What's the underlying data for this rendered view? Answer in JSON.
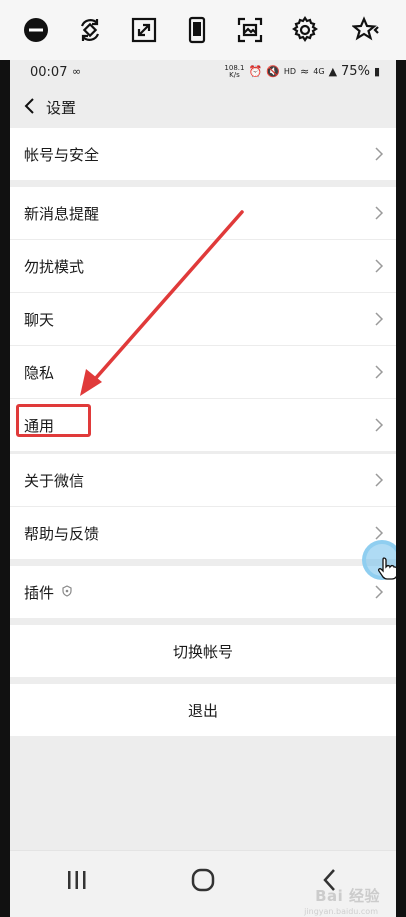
{
  "status_bar": {
    "time": "00:07",
    "network_speed_value": "108.1",
    "network_speed_unit": "K/s",
    "signal_label": "4G",
    "battery": "75%"
  },
  "header": {
    "title": "设置"
  },
  "groups": [
    {
      "items": [
        {
          "label": "帐号与安全"
        }
      ]
    },
    {
      "items": [
        {
          "label": "新消息提醒"
        },
        {
          "label": "勿扰模式"
        },
        {
          "label": "聊天"
        },
        {
          "label": "隐私"
        },
        {
          "label": "通用"
        }
      ]
    },
    {
      "items": [
        {
          "label": "关于微信"
        },
        {
          "label": "帮助与反馈"
        }
      ]
    },
    {
      "items": [
        {
          "label": "插件"
        }
      ]
    }
  ],
  "actions": {
    "switch_account": "切换帐号",
    "logout": "退出"
  },
  "watermark": {
    "text": "Bai 经验",
    "subtext": "jingyan.baidu.com"
  },
  "colors": {
    "annotation_red": "#e03a3a",
    "touch_blue": "#6ebeeb",
    "page_bg": "#ededed",
    "row_bg": "#ffffff"
  },
  "icons": {
    "toolbar": [
      "minus-circle-icon",
      "rotate-icon",
      "expand-icon",
      "phone-icon",
      "screenshot-icon",
      "gear-icon",
      "star-icon"
    ],
    "nav": [
      "recent-apps-icon",
      "home-icon",
      "back-icon"
    ]
  }
}
